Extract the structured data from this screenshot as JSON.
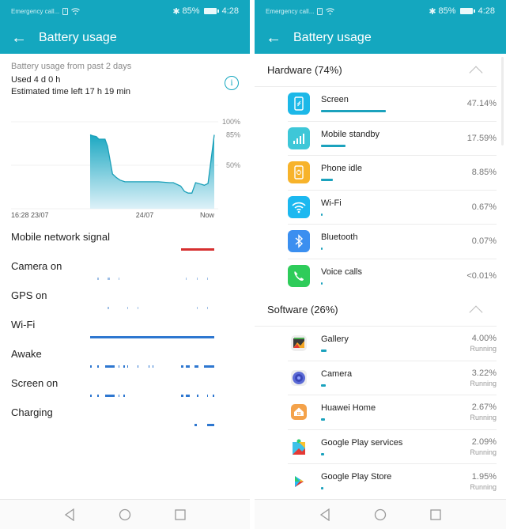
{
  "status_bar": {
    "carrier": "Emergency call...",
    "battery_percent": "85%",
    "time": "4:28"
  },
  "app_bar": {
    "title": "Battery usage",
    "back_icon": "arrow-left-icon"
  },
  "left": {
    "summary": {
      "title": "Battery usage from past 2 days",
      "used": "Used 4 d 0 h",
      "estimated": "Estimated time left 17 h 19 min",
      "info_icon": "info-icon"
    },
    "chart_data": {
      "type": "area",
      "title": "",
      "y_ticks": [
        "100%",
        "85%",
        "50%"
      ],
      "x_ticks": [
        "16:28 23/07",
        "24/07",
        "Now"
      ],
      "ylim": [
        0,
        100
      ],
      "grid": true,
      "x": [
        0.0,
        0.02,
        0.05,
        0.07,
        0.12,
        0.14,
        0.18,
        0.21,
        0.24,
        0.28,
        0.38,
        0.55,
        0.64,
        0.67,
        0.73,
        0.76,
        0.79,
        0.82,
        0.85,
        0.9,
        0.92,
        0.95,
        1.0
      ],
      "values": [
        85,
        84,
        83,
        80,
        80,
        72,
        40,
        36,
        33,
        31,
        31,
        31,
        30,
        30,
        26,
        20,
        18,
        18,
        30,
        28,
        27,
        29,
        85
      ],
      "series_start_fraction": 0.0
    },
    "timelines": [
      {
        "label": "Mobile network signal",
        "color": "#d62f2f",
        "segments": [
          [
            0.73,
            1.0
          ]
        ]
      },
      {
        "label": "Camera on",
        "color": "#9fbfe6",
        "segments": [
          [
            0.06,
            0.065
          ],
          [
            0.14,
            0.16
          ],
          [
            0.23,
            0.235
          ],
          [
            0.77,
            0.775
          ],
          [
            0.86,
            0.865
          ],
          [
            0.94,
            0.945
          ]
        ]
      },
      {
        "label": "GPS on",
        "color": "#9fbfe6",
        "segments": [
          [
            0.14,
            0.15
          ],
          [
            0.3,
            0.305
          ],
          [
            0.38,
            0.385
          ],
          [
            0.86,
            0.865
          ],
          [
            0.94,
            0.945
          ]
        ]
      },
      {
        "label": "Wi-Fi",
        "color": "#2e77d0",
        "segments": [
          [
            0.0,
            1.0
          ]
        ]
      },
      {
        "label": "Awake",
        "color": "#2e77d0",
        "segments": [
          [
            0.0,
            0.01
          ],
          [
            0.06,
            0.07
          ],
          [
            0.12,
            0.2
          ],
          [
            0.23,
            0.235
          ],
          [
            0.27,
            0.275
          ],
          [
            0.3,
            0.305
          ],
          [
            0.38,
            0.385
          ],
          [
            0.47,
            0.475
          ],
          [
            0.5,
            0.505
          ],
          [
            0.73,
            0.75
          ],
          [
            0.77,
            0.8
          ],
          [
            0.84,
            0.87
          ],
          [
            0.92,
            1.0
          ]
        ]
      },
      {
        "label": "Screen on",
        "color": "#2e77d0",
        "segments": [
          [
            0.0,
            0.01
          ],
          [
            0.06,
            0.07
          ],
          [
            0.12,
            0.2
          ],
          [
            0.23,
            0.235
          ],
          [
            0.27,
            0.275
          ],
          [
            0.73,
            0.75
          ],
          [
            0.77,
            0.8
          ],
          [
            0.86,
            0.875
          ],
          [
            0.94,
            0.945
          ],
          [
            0.99,
            1.0
          ]
        ]
      },
      {
        "label": "Charging",
        "color": "#2e77d0",
        "segments": [
          [
            0.84,
            0.86
          ],
          [
            0.94,
            1.0
          ]
        ]
      }
    ]
  },
  "right": {
    "sections": [
      {
        "title": "Hardware (74%)",
        "items": [
          {
            "name": "Screen",
            "percent": "47.14%",
            "fraction": 0.4714,
            "icon": "screen-icon",
            "color": "#1cb8e8"
          },
          {
            "name": "Mobile standby",
            "percent": "17.59%",
            "fraction": 0.1759,
            "icon": "signal-icon",
            "color": "#3ec7d8"
          },
          {
            "name": "Phone idle",
            "percent": "8.85%",
            "fraction": 0.0885,
            "icon": "phone-idle-icon",
            "color": "#f7b32b"
          },
          {
            "name": "Wi-Fi",
            "percent": "0.67%",
            "fraction": 0.0067,
            "icon": "wifi-icon",
            "color": "#1cb8f0"
          },
          {
            "name": "Bluetooth",
            "percent": "0.07%",
            "fraction": 0.0007,
            "icon": "bluetooth-icon",
            "color": "#3b8ff0"
          },
          {
            "name": "Voice calls",
            "percent": "<0.01%",
            "fraction": 0.0001,
            "icon": "phone-icon",
            "color": "#2ecc5a"
          }
        ]
      },
      {
        "title": "Software (26%)",
        "items": [
          {
            "name": "Gallery",
            "percent": "4.00%",
            "status": "Running",
            "fraction": 0.04,
            "icon": "gallery-icon"
          },
          {
            "name": "Camera",
            "percent": "3.22%",
            "status": "Running",
            "fraction": 0.0322,
            "icon": "camera-icon"
          },
          {
            "name": "Huawei Home",
            "percent": "2.67%",
            "status": "Running",
            "fraction": 0.0267,
            "icon": "home-icon"
          },
          {
            "name": "Google Play services",
            "percent": "2.09%",
            "status": "Running",
            "fraction": 0.0209,
            "icon": "play-services-icon"
          },
          {
            "name": "Google Play Store",
            "percent": "1.95%",
            "status": "Running",
            "fraction": 0.0195,
            "icon": "play-store-icon"
          }
        ]
      }
    ]
  },
  "nav": {
    "back": "nav-back-icon",
    "home": "nav-home-icon",
    "recents": "nav-recents-icon"
  }
}
